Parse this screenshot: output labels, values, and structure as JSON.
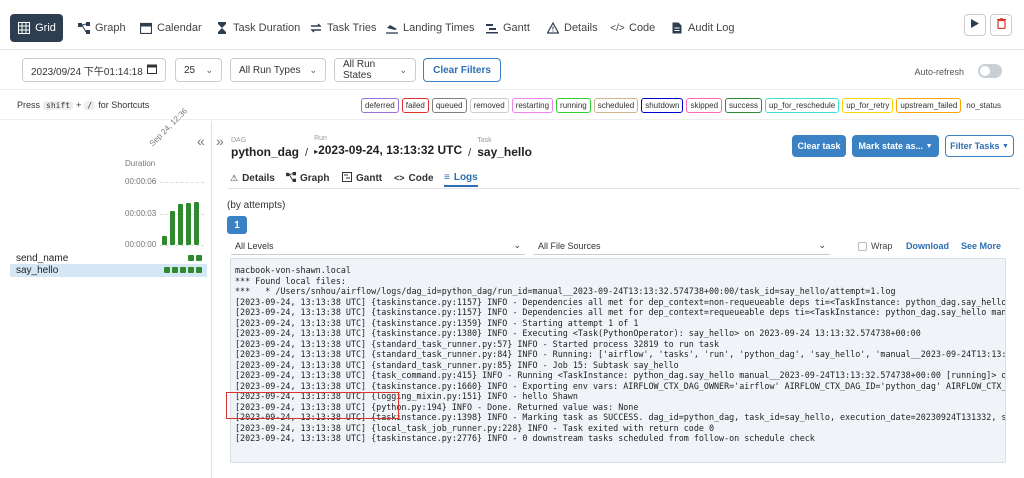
{
  "topnav": {
    "tabs": [
      {
        "label": "Grid",
        "icon": "grid-icon",
        "active": true
      },
      {
        "label": "Graph",
        "icon": "graph-icon"
      },
      {
        "label": "Calendar",
        "icon": "calendar-icon"
      },
      {
        "label": "Task Duration",
        "icon": "hourglass-icon"
      },
      {
        "label": "Task Tries",
        "icon": "retry-icon"
      },
      {
        "label": "Landing Times",
        "icon": "landing-icon"
      },
      {
        "label": "Gantt",
        "icon": "gantt-icon"
      },
      {
        "label": "Details",
        "icon": "warning-triangle-icon"
      },
      {
        "label": "Code",
        "icon": "code-icon"
      },
      {
        "label": "Audit Log",
        "icon": "document-icon"
      }
    ],
    "play_icon": "play-icon",
    "delete_icon": "trash-icon"
  },
  "filters": {
    "date": "2023/09/24 下午01:14:18",
    "count": "25",
    "run_types": "All Run Types",
    "run_states": "All Run States",
    "clear_label": "Clear Filters",
    "auto_refresh": "Auto-refresh"
  },
  "shortcuts": {
    "press": "Press",
    "key1": "shift",
    "plus": "+",
    "key2": "/",
    "text": "for Shortcuts"
  },
  "legend": [
    {
      "label": "deferred",
      "color": "#9370db"
    },
    {
      "label": "failed",
      "color": "#d9342b"
    },
    {
      "label": "queued",
      "color": "#808080"
    },
    {
      "label": "removed",
      "color": "#cccccc"
    },
    {
      "label": "restarting",
      "color": "#ee82ee"
    },
    {
      "label": "running",
      "color": "#32cd32"
    },
    {
      "label": "scheduled",
      "color": "#d2b48c"
    },
    {
      "label": "shutdown",
      "color": "#0000cc"
    },
    {
      "label": "skipped",
      "color": "#ff69b4"
    },
    {
      "label": "success",
      "color": "#2f8a2f"
    },
    {
      "label": "up_for_reschedule",
      "color": "#40e0d0"
    },
    {
      "label": "up_for_retry",
      "color": "#ffd700"
    },
    {
      "label": "upstream_failed",
      "color": "#ffa500"
    },
    {
      "label": "no_status",
      "color": ""
    }
  ],
  "grid": {
    "duration_label": "Duration",
    "date_label": "Sep 24, 12:36",
    "yticks": [
      "00:00:06",
      "00:00:03",
      "00:00:00"
    ],
    "bar_levels": [
      0.15,
      0.54,
      0.65,
      0.66,
      0.68
    ],
    "tasks": [
      "send_name",
      "say_hello"
    ]
  },
  "details": {
    "dag_key": "DAG",
    "dag": "python_dag",
    "run_key": "Run",
    "run": "2023-09-24, 13:13:32 UTC",
    "task_key": "Task",
    "task": "say_hello",
    "clear_task": "Clear task",
    "mark_state": "Mark state as...",
    "filter_tasks": "Filter Tasks",
    "tabs": [
      "Details",
      "Graph",
      "Gantt",
      "Code",
      "Logs"
    ],
    "attempts_label": "(by attempts)",
    "attempt": "1",
    "levels": "All Levels",
    "sources": "All File Sources",
    "wrap": "Wrap",
    "download": "Download",
    "see_more": "See More"
  },
  "log": [
    "macbook-von-shawn.local",
    "*** Found local files:",
    "***   * /Users/snhou/airflow/logs/dag_id=python_dag/run_id=manual__2023-09-24T13:13:32.574738+00:00/task_id=say_hello/attempt=1.log",
    "[2023-09-24, 13:13:38 UTC] {taskinstance.py:1157} INFO - Dependencies all met for dep_context=non-requeueable deps ti=<TaskInstance: python_dag.say_hello manual",
    "[2023-09-24, 13:13:38 UTC] {taskinstance.py:1157} INFO - Dependencies all met for dep_context=requeueable deps ti=<TaskInstance: python_dag.say_hello manual__20",
    "[2023-09-24, 13:13:38 UTC] {taskinstance.py:1359} INFO - Starting attempt 1 of 1",
    "[2023-09-24, 13:13:38 UTC] {taskinstance.py:1380} INFO - Executing <Task(PythonOperator): say_hello> on 2023-09-24 13:13:32.574738+00:00",
    "[2023-09-24, 13:13:38 UTC] {standard_task_runner.py:57} INFO - Started process 32819 to run task",
    "[2023-09-24, 13:13:38 UTC] {standard_task_runner.py:84} INFO - Running: ['airflow', 'tasks', 'run', 'python_dag', 'say_hello', 'manual__2023-09-24T13:13:32.5747",
    "[2023-09-24, 13:13:38 UTC] {standard_task_runner.py:85} INFO - Job 15: Subtask say_hello",
    "[2023-09-24, 13:13:38 UTC] {task_command.py:415} INFO - Running <TaskInstance: python_dag.say_hello manual__2023-09-24T13:13:32.574738+00:00 [running]> on host",
    "[2023-09-24, 13:13:38 UTC] {taskinstance.py:1660} INFO - Exporting env vars: AIRFLOW_CTX_DAG_OWNER='airflow' AIRFLOW_CTX_DAG_ID='python_dag' AIRFLOW_CTX_TASK_ID",
    "[2023-09-24, 13:13:38 UTC] {logging_mixin.py:151} INFO - hello Shawn",
    "[2023-09-24, 13:13:38 UTC] {python.py:194} INFO - Done. Returned value was: None",
    "[2023-09-24, 13:13:38 UTC] {taskinstance.py:1398} INFO - Marking task as SUCCESS. dag_id=python_dag, task_id=say_hello, execution_date=20230924T131332, start_da",
    "[2023-09-24, 13:13:38 UTC] {local_task_job_runner.py:228} INFO - Task exited with return code 0",
    "[2023-09-24, 13:13:38 UTC] {taskinstance.py:2776} INFO - 0 downstream tasks scheduled from follow-on schedule check"
  ]
}
